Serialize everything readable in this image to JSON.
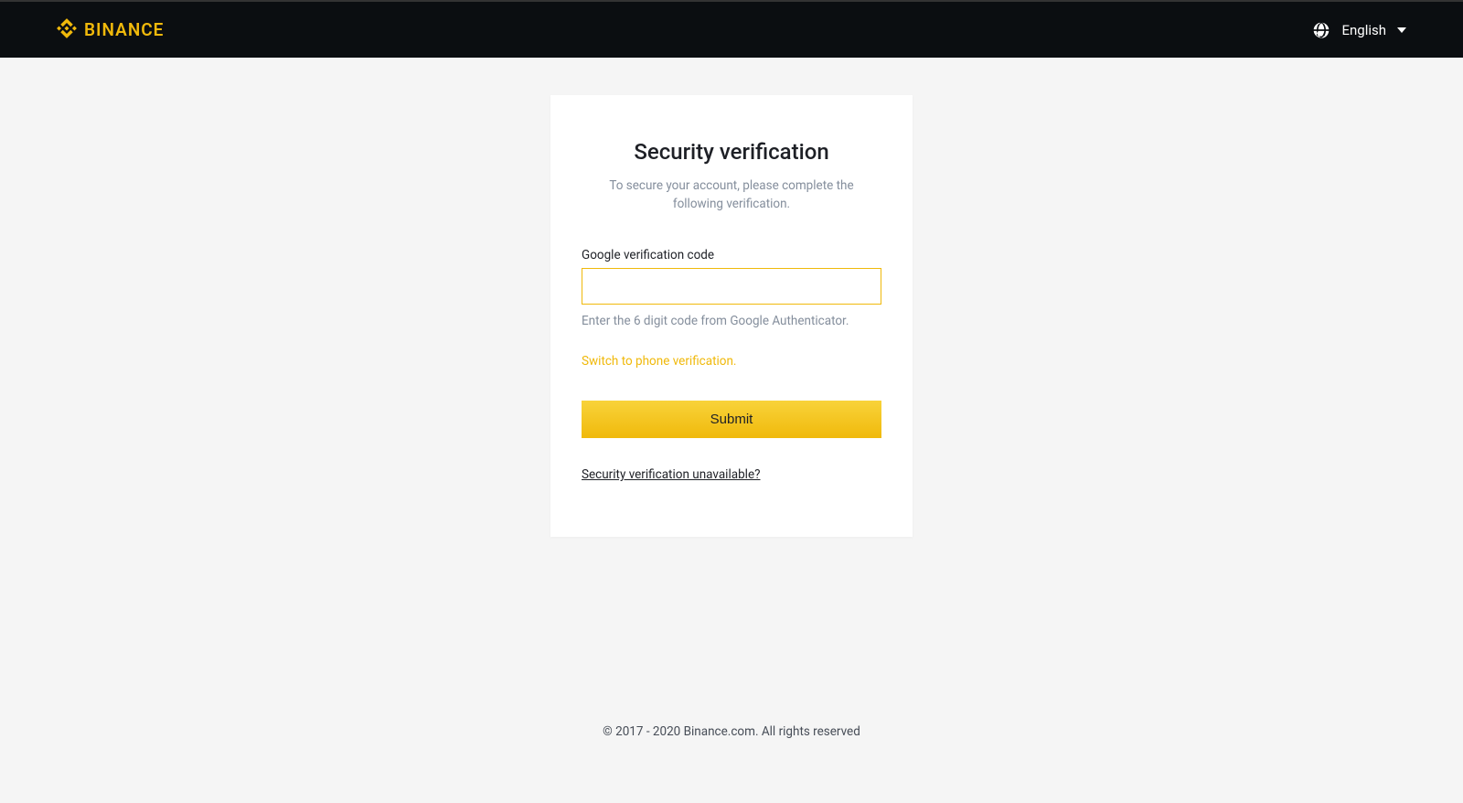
{
  "header": {
    "brand": "BINANCE",
    "lang_label": "English"
  },
  "card": {
    "title": "Security verification",
    "subtitle": "To secure your account, please complete the following verification.",
    "field_label": "Google verification code",
    "hint": "Enter the 6 digit code from Google Authenticator.",
    "switch_link": "Switch to phone verification.",
    "submit": "Submit",
    "unavailable": "Security verification unavailable?"
  },
  "footer": {
    "copyright": "© 2017 - 2020 Binance.com. All rights reserved"
  }
}
